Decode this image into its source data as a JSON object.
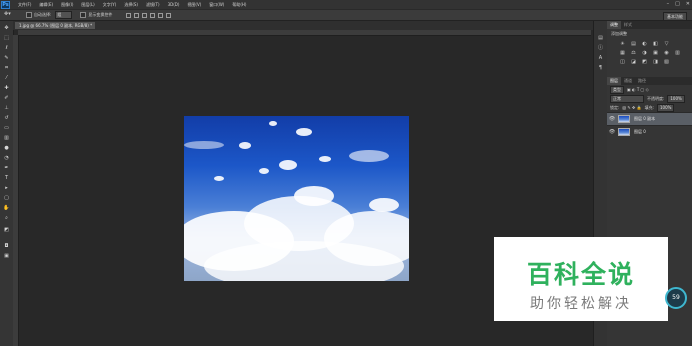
{
  "app": {
    "logo": "Ps"
  },
  "menu": [
    "文件(F)",
    "编辑(E)",
    "图像(I)",
    "图层(L)",
    "文字(Y)",
    "选择(S)",
    "滤镜(T)",
    "3D(D)",
    "视图(V)",
    "窗口(W)",
    "帮助(H)"
  ],
  "window_controls": [
    "minimize-icon",
    "maximize-icon",
    "close-icon"
  ],
  "options": {
    "tool_icon": "move-tool-icon",
    "auto_select_label": "自动选择:",
    "auto_select_value": "组",
    "show_transform_label": "显示变换控件",
    "workspace": "基本功能"
  },
  "document_tab": {
    "label": "1.jpg @ 66.7% (图层 0 副本, RGB/8) *"
  },
  "panels": {
    "top_tabs": [
      "调整",
      "样式"
    ],
    "adjustments_title": "添加调整",
    "adjustment_icons": [
      "☀",
      "▤",
      "◐",
      "◧",
      "▽",
      "",
      "▦",
      "⚖",
      "◑",
      "▣",
      "◉",
      "▥",
      "◫",
      "◪",
      "◩",
      "◨",
      "▧",
      ""
    ],
    "layer_tabs": [
      "图层",
      "通道",
      "路径"
    ],
    "filter_label": "类型",
    "blend_mode": "正常",
    "opacity_label": "不透明度:",
    "opacity_value": "100%",
    "lock_label": "锁定:",
    "fill_label": "填充:",
    "fill_value": "100%",
    "layers": [
      {
        "name": "图层 0 副本",
        "selected": true
      },
      {
        "name": "图层 0",
        "selected": false
      }
    ]
  },
  "watermark": {
    "title": "百科全说",
    "subtitle": "助你轻松解决"
  },
  "badge": {
    "value": "59"
  }
}
